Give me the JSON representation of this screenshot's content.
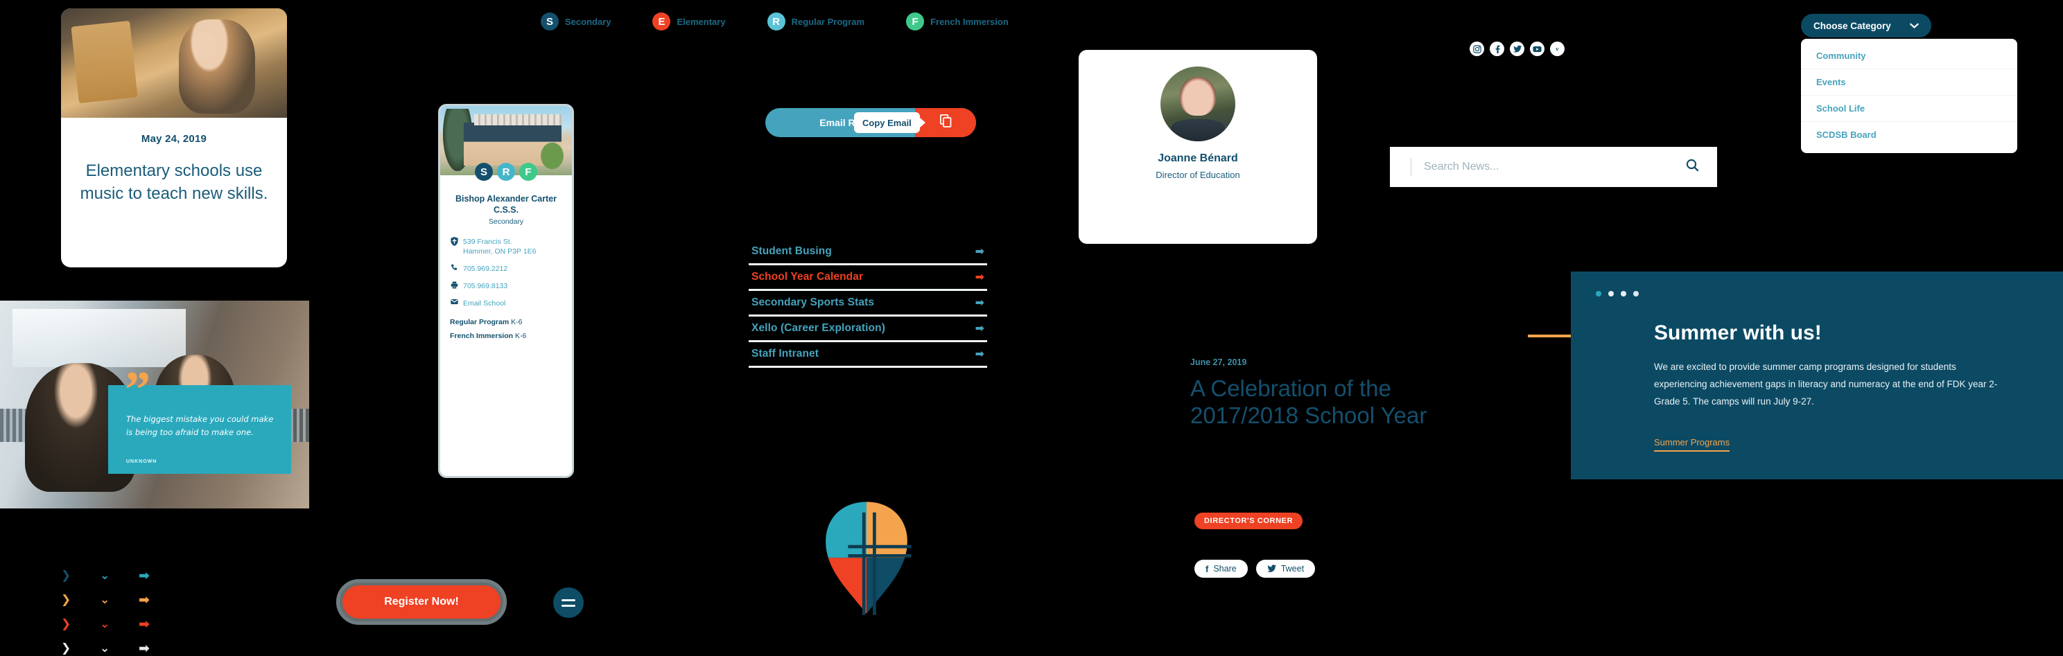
{
  "news_card": {
    "date": "May 24, 2019",
    "headline": "Elementary schools use music to teach new skills.",
    "image_alt": "student-playing-guitar-photo"
  },
  "badge_legend": [
    {
      "letter": "S",
      "label": "Secondary",
      "color": "#14506e"
    },
    {
      "letter": "E",
      "label": "Elementary",
      "color": "#ef4123"
    },
    {
      "letter": "R",
      "label": "Regular Program",
      "color": "#5bc3d6"
    },
    {
      "letter": "F",
      "label": "French Immersion",
      "color": "#3ec98a"
    }
  ],
  "quote_block": {
    "image_alt": "students-in-classroom-photo",
    "quote": "The biggest mistake you could make is being too afraid to make one.",
    "attribution": "UNKNOWN",
    "quote_mark": "”",
    "card_color": "#2aa9bd",
    "mark_color": "#f4a44d"
  },
  "arrow_grid": {
    "chevron_right": "❯",
    "chevron_down": "⌄",
    "arrow_right": "➡",
    "rows": [
      {
        "color": "#14506e",
        "arrow_color": "#2aa9bd"
      },
      {
        "color": "#f4a44d",
        "arrow_color": "#f4a44d"
      },
      {
        "color": "#ef4123",
        "arrow_color": "#ef4123"
      },
      {
        "color": "#e3eaec",
        "arrow_color": "#e3eaec"
      }
    ]
  },
  "school_card": {
    "image_alt": "school-building-photo",
    "badges": [
      {
        "letter": "S",
        "color": "#14506e"
      },
      {
        "letter": "R",
        "color": "#45b6c9"
      },
      {
        "letter": "F",
        "color": "#3ec98a"
      }
    ],
    "name": "Bishop Alexander Carter C.S.S.",
    "level": "Secondary",
    "address_line1": "539 Francis St.",
    "address_line2": "Hammer, ON P3P 1E6",
    "phone": "705.969.2212",
    "fax": "705.969.8133",
    "email_label": "Email School",
    "programs": [
      {
        "name": "Regular Program",
        "grades": "K-6"
      },
      {
        "name": "French Immersion",
        "grades": "K-6"
      }
    ],
    "icons": {
      "address": "shield-icon",
      "phone": "phone-icon",
      "fax": "printer-icon",
      "email": "envelope-icon"
    }
  },
  "email_button": {
    "label": "Email Rose",
    "copy_icon": "copy-icon",
    "tooltip": "Copy Email",
    "base_color": "#45a3bd",
    "action_color": "#ef4123"
  },
  "link_list": [
    {
      "label": "Student Busing",
      "color": "#45a3bd",
      "arrow": "➡"
    },
    {
      "label": "School Year Calendar",
      "color": "#ef4123",
      "arrow": "➡"
    },
    {
      "label": "Secondary Sports Stats",
      "color": "#45a3bd",
      "arrow": "➡"
    },
    {
      "label": "Xello (Career Exploration)",
      "color": "#45a3bd",
      "arrow": "➡"
    },
    {
      "label": "Staff Intranet",
      "color": "#45a3bd",
      "arrow": "➡"
    }
  ],
  "brand_logo": {
    "name": "scdsb-cross-shield-logo",
    "colors": [
      "#2aa9bd",
      "#f4a44d",
      "#ef4123",
      "#0f4c66"
    ]
  },
  "register_button": {
    "label": "Register Now!",
    "color": "#ef4123"
  },
  "menu_button": {
    "name": "hamburger-menu",
    "color": "#0f4c66"
  },
  "director_card": {
    "image_alt": "joanne-benard-headshot",
    "name": "Joanne Bénard",
    "role": "Director of Education"
  },
  "article": {
    "date": "June 27, 2019",
    "title": "A Celebration of the 2017/2018 School Year",
    "tag": "DIRECTOR'S CORNER",
    "share_buttons": [
      {
        "label": "Share",
        "icon": "facebook-icon",
        "glyph": "f"
      },
      {
        "label": "Tweet",
        "icon": "twitter-icon",
        "glyph": "ᴠ"
      }
    ]
  },
  "social_row": [
    {
      "name": "instagram-icon"
    },
    {
      "name": "facebook-icon"
    },
    {
      "name": "twitter-icon"
    },
    {
      "name": "youtube-icon"
    },
    {
      "name": "vimeo-icon"
    }
  ],
  "search": {
    "value": "",
    "placeholder": "Search News...",
    "icon": "search-icon"
  },
  "category": {
    "button_label": "Choose Category",
    "chevron": "⌄",
    "options": [
      "Community",
      "Events",
      "School Life",
      "SCDSB Board"
    ]
  },
  "summer_panel": {
    "title": "Summer with us!",
    "body": "We are excited to provide summer camp programs designed for students experiencing achievement gaps in literacy and numeracy at the end of FDK year 2- Grade 5. The camps will run July 9-27.",
    "link_label": "Summer Programs",
    "bg_color": "#0c4a64",
    "accent_color": "#f4a44d",
    "dots": [
      {
        "color": "#2aa9bd"
      },
      {
        "color": "#e8eff1"
      },
      {
        "color": "#e8eff1"
      },
      {
        "color": "#dde7ea"
      }
    ]
  }
}
